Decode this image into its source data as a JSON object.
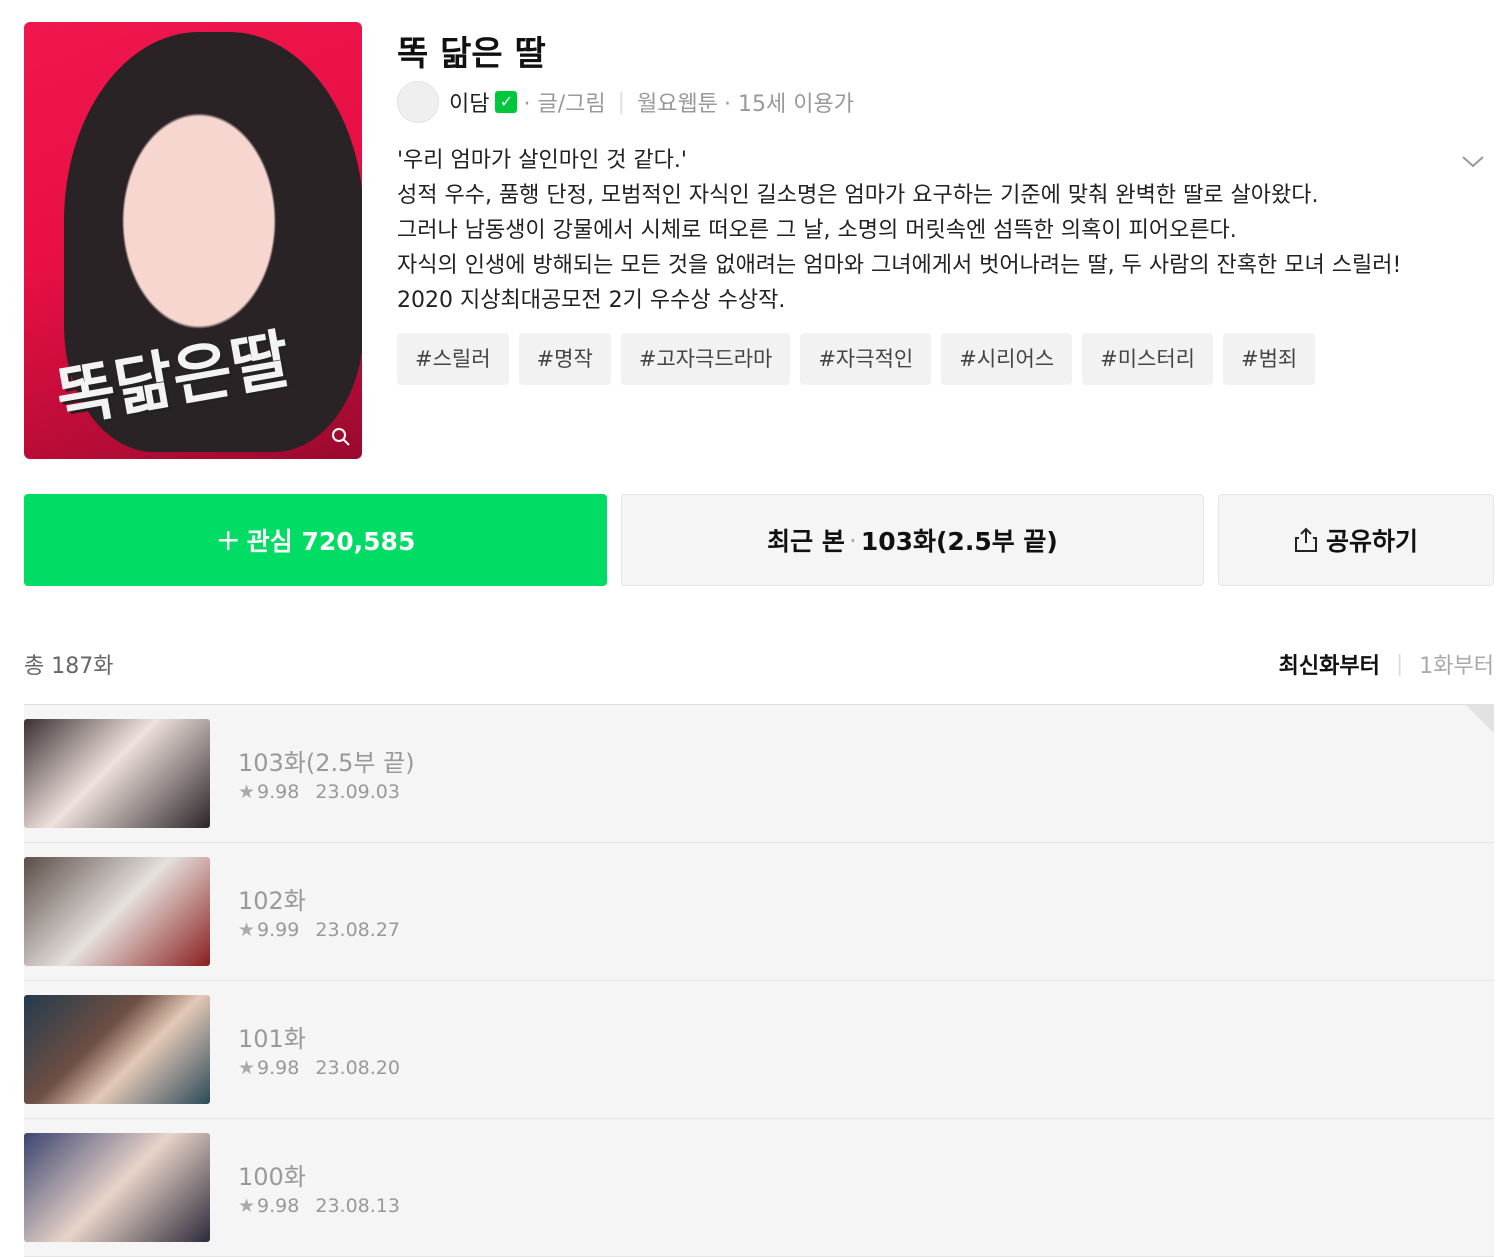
{
  "title": "똑 닮은 딸",
  "cover": {
    "logo_text": "똑닮은딸"
  },
  "author": {
    "name": "이담",
    "role": "· 글/그림",
    "day": "월요웹툰",
    "age": "· 15세 이용가"
  },
  "description": [
    "'우리 엄마가 살인마인 것 같다.'",
    "성적 우수, 품행 단정, 모범적인 자식인 길소명은 엄마가 요구하는 기준에 맞춰 완벽한 딸로 살아왔다.",
    "그러나 남동생이 강물에서 시체로 떠오른 그 날, 소명의 머릿속엔 섬뜩한 의혹이 피어오른다.",
    "자식의 인생에 방해되는 모든 것을 없애려는 엄마와 그녀에게서 벗어나려는 딸, 두 사람의 잔혹한 모녀 스릴러!",
    "2020 지상최대공모전 2기 우수상 수상작."
  ],
  "tags": [
    "#스릴러",
    "#명작",
    "#고자극드라마",
    "#자극적인",
    "#시리어스",
    "#미스터리",
    "#범죄"
  ],
  "buttons": {
    "fav_label": "관심 720,585",
    "recent_prefix": "최근 본",
    "recent_episode": "103화(2.5부 끝)",
    "share_label": "공유하기"
  },
  "list": {
    "total": "총 187화",
    "sort_latest": "최신화부터",
    "sort_first": "1화부터",
    "episodes": [
      {
        "title": "103화(2.5부 끝)",
        "rating": "9.98",
        "date": "23.09.03"
      },
      {
        "title": "102화",
        "rating": "9.99",
        "date": "23.08.27"
      },
      {
        "title": "101화",
        "rating": "9.98",
        "date": "23.08.20"
      },
      {
        "title": "100화",
        "rating": "9.98",
        "date": "23.08.13"
      }
    ]
  },
  "colors": {
    "accent": "#00dc64",
    "verified": "#00c73c"
  }
}
